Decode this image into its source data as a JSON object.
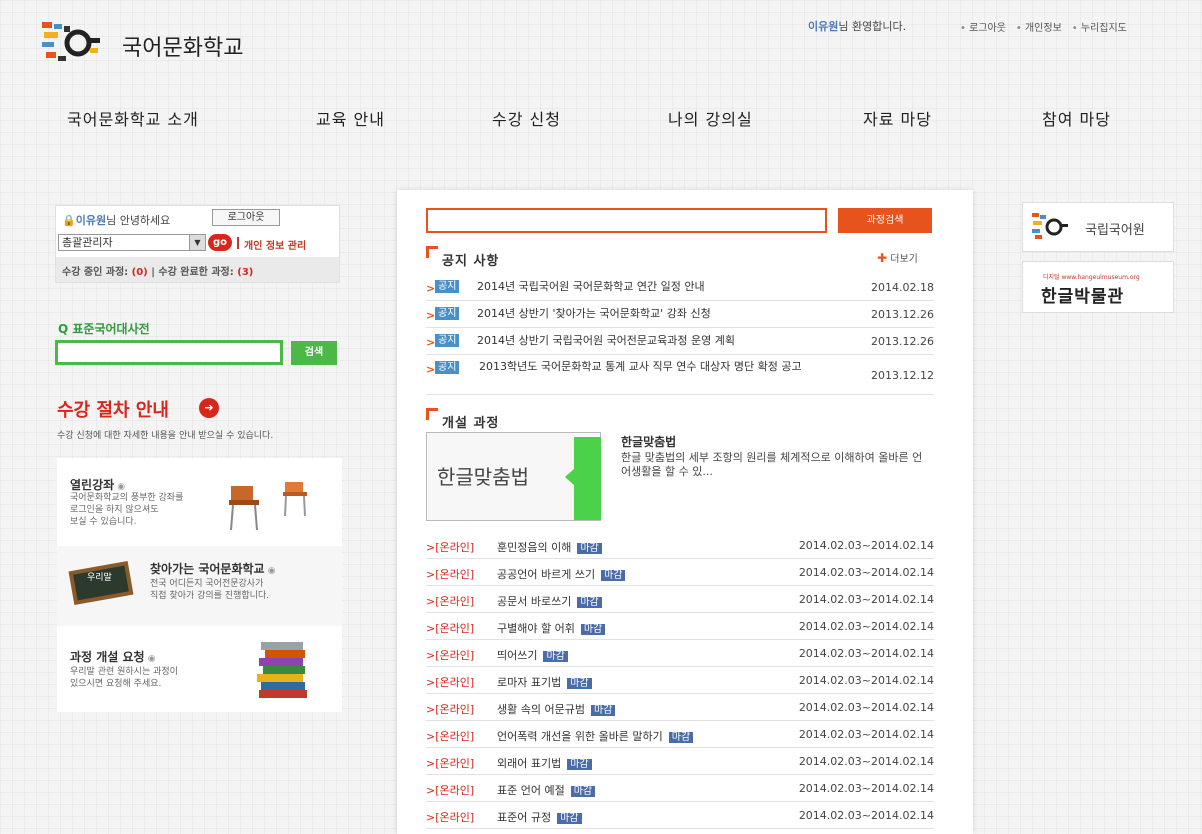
{
  "header": {
    "site_title": "국어문화학교",
    "welcome_user": "이유원",
    "welcome_text": "님 환영합니다.",
    "links": [
      "로그아웃",
      "개인정보",
      "누리집지도"
    ]
  },
  "gnb": [
    "국어문화학교 소개",
    "교육 안내",
    "수강 신청",
    "나의 강의실",
    "자료 마당",
    "참여 마당"
  ],
  "login": {
    "user": "이유원",
    "greet_suffix": "님 안녕하세요",
    "logout_label": "로그아웃",
    "role_value": "총괄관리자",
    "go_label": "go",
    "privacy_label": "개인 정보 관리",
    "stat_ongoing_label": "수강 중인 과정:",
    "stat_ongoing": "(0)",
    "stat_sep": "|",
    "stat_done_label": "수강 완료한 과정:",
    "stat_done": "(3)"
  },
  "dictionary": {
    "label": "Q 표준국어대사전",
    "search_value": "",
    "search_button": "검색"
  },
  "procedure": {
    "title": "수강 절차 안내",
    "arrow": "➜",
    "desc": "수강 신청에 대한 자세한 내용을 안내 받으실 수 있습니다."
  },
  "promos": [
    {
      "title": "열린강좌",
      "desc": "국어문화학교의 풍부한 강좌를\n로그인을 하지 않으셔도\n보실 수 있습니다."
    },
    {
      "title": "찾아가는 국어문화학교",
      "desc": "전국 어디든지 국어전문강사가\n직접 찾아가 강의를 진행합니다.",
      "board": "우리말"
    },
    {
      "title": "과정 개설 요청",
      "desc": "우리말 관련 원하시는 과정이\n있으시면 요청해 주세요."
    }
  ],
  "search": {
    "value": "",
    "button": "과정검색"
  },
  "notice": {
    "title": "공지 사항",
    "more": "더보기",
    "items": [
      {
        "tag": "공지",
        "title": "2014년 국립국어원 국어문화학교 연간 일정 안내",
        "date": "2014.02.18"
      },
      {
        "tag": "공지",
        "title": "2014년 상반기 '찾아가는 국어문화학교' 강좌 신청",
        "date": "2013.12.26"
      },
      {
        "tag": "공지",
        "title": "2014년 상반기 국립국어원 국어전문교육과정 운영 계획",
        "date": "2013.12.26"
      },
      {
        "tag": "공지",
        "title": "2013학년도 국어문화학교 통계 교사 직무 연수 대상자 명단 확정 공고",
        "date": "2013.12.12"
      }
    ]
  },
  "courses": {
    "title": "개설 과정",
    "featured": {
      "thumb_text": "한글맞춤법",
      "name": "한글맞춤법",
      "desc": "한글 맞춤법의 세부 조항의 원리를 체계적으로 이해하여 올바른 언어생활을 할 수 있..."
    },
    "items": [
      {
        "category": ">[온라인]",
        "name": "훈민정음의 이해",
        "status": "마감",
        "period": "2014.02.03~2014.02.14"
      },
      {
        "category": ">[온라인]",
        "name": "공공언어 바르게 쓰기",
        "status": "마감",
        "period": "2014.02.03~2014.02.14"
      },
      {
        "category": ">[온라인]",
        "name": "공문서 바로쓰기",
        "status": "마감",
        "period": "2014.02.03~2014.02.14"
      },
      {
        "category": ">[온라인]",
        "name": "구별해야 할 어휘",
        "status": "마감",
        "period": "2014.02.03~2014.02.14"
      },
      {
        "category": ">[온라인]",
        "name": "띄어쓰기",
        "status": "마감",
        "period": "2014.02.03~2014.02.14"
      },
      {
        "category": ">[온라인]",
        "name": "로마자 표기법",
        "status": "마감",
        "period": "2014.02.03~2014.02.14"
      },
      {
        "category": ">[온라인]",
        "name": "생활 속의 어문규범",
        "status": "마감",
        "period": "2014.02.03~2014.02.14"
      },
      {
        "category": ">[온라인]",
        "name": "언어폭력 개선을 위한 올바른 말하기",
        "status": "마감",
        "period": "2014.02.03~2014.02.14"
      },
      {
        "category": ">[온라인]",
        "name": "외래어 표기법",
        "status": "마감",
        "period": "2014.02.03~2014.02.14"
      },
      {
        "category": ">[온라인]",
        "name": "표준 언어 예절",
        "status": "마감",
        "period": "2014.02.03~2014.02.14"
      },
      {
        "category": ">[온라인]",
        "name": "표준어 규정",
        "status": "마감",
        "period": "2014.02.03~2014.02.14"
      }
    ]
  },
  "banners": {
    "nikl": "국립국어원",
    "museum_sub": "디지털 www.hangeulmuseum.org",
    "museum": "한글박물관"
  },
  "colors": {
    "accent": "#e8521d",
    "red": "#d8261c",
    "green": "#4cb848",
    "tag_blue": "#4a90c8"
  }
}
